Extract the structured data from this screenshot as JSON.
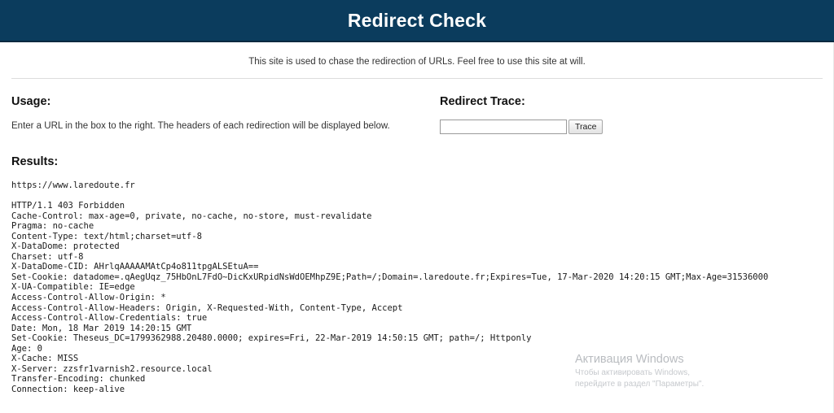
{
  "header": {
    "title": "Redirect Check",
    "bg_color": "#0b3c5d",
    "text_color": "#ffffff"
  },
  "intro": {
    "text": "This site is used to chase the redirection of URLs. Feel free to use this site at will."
  },
  "usage": {
    "heading": "Usage:",
    "description": "Enter a URL in the box to the right. The headers of each redirection will be displayed below."
  },
  "trace": {
    "heading": "Redirect Trace:",
    "input_value": "",
    "input_placeholder": "",
    "button_label": "Trace"
  },
  "results": {
    "heading": "Results:",
    "url": "https://www.laredoute.fr",
    "headers": [
      "HTTP/1.1 403 Forbidden",
      "Cache-Control: max-age=0, private, no-cache, no-store, must-revalidate",
      "Pragma: no-cache",
      "Content-Type: text/html;charset=utf-8",
      "X-DataDome: protected",
      "Charset: utf-8",
      "X-DataDome-CID: AHrlqAAAAAMAtCp4o811tpgALSEtuA==",
      "Set-Cookie: datadome=.qAegUqz_75HbOnL7FdO~DicKxURpidNsWdOEMhpZ9E;Path=/;Domain=.laredoute.fr;Expires=Tue, 17-Mar-2020 14:20:15 GMT;Max-Age=31536000",
      "X-UA-Compatible: IE=edge",
      "Access-Control-Allow-Origin: *",
      "Access-Control-Allow-Headers: Origin, X-Requested-With, Content-Type, Accept",
      "Access-Control-Allow-Credentials: true",
      "Date: Mon, 18 Mar 2019 14:20:15 GMT",
      "Set-Cookie: Theseus_DC=1799362988.20480.0000; expires=Fri, 22-Mar-2019 14:50:15 GMT; path=/; Httponly",
      "Age: 0",
      "X-Cache: MISS",
      "X-Server: zzsfr1varnish2.resource.local",
      "Transfer-Encoding: chunked",
      "Connection: keep-alive"
    ]
  },
  "windows_activation": {
    "title": "Активация Windows",
    "subtitle": "Чтобы активировать Windows, перейдите в раздел \"Параметры\"."
  }
}
